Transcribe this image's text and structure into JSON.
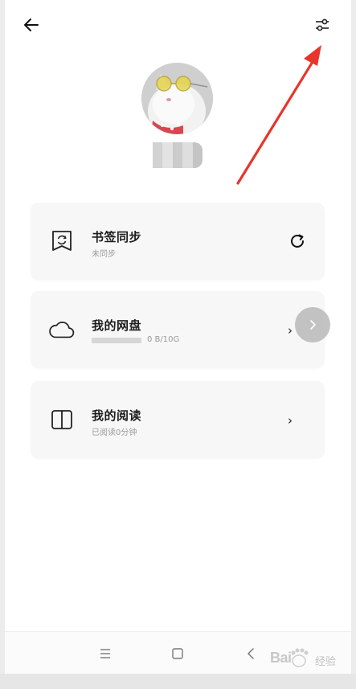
{
  "cards": [
    {
      "title": "书签同步",
      "subtitle": "未同步",
      "action_icon": "refresh-icon",
      "icon": "bookmark-sync-icon"
    },
    {
      "title": "我的网盘",
      "storage_text": "0 B/10G",
      "storage_used_fraction": 0,
      "action_icon": "chevron-right-icon",
      "icon": "cloud-icon"
    },
    {
      "title": "我的阅读",
      "subtitle": "已阅读0分钟",
      "action_icon": "chevron-right-icon",
      "icon": "book-icon"
    }
  ],
  "chevron_glyph": "›",
  "nav": {
    "menu_icon": "menu-icon",
    "home_icon": "home-icon",
    "back_icon": "back-icon"
  },
  "watermark": {
    "brand": "Bai",
    "suffix": "经验"
  },
  "colors": {
    "annotation": "#e8352c",
    "card_bg": "#f7f7f7",
    "text": "#1c1c1c",
    "subtext": "#9a9a9a"
  }
}
